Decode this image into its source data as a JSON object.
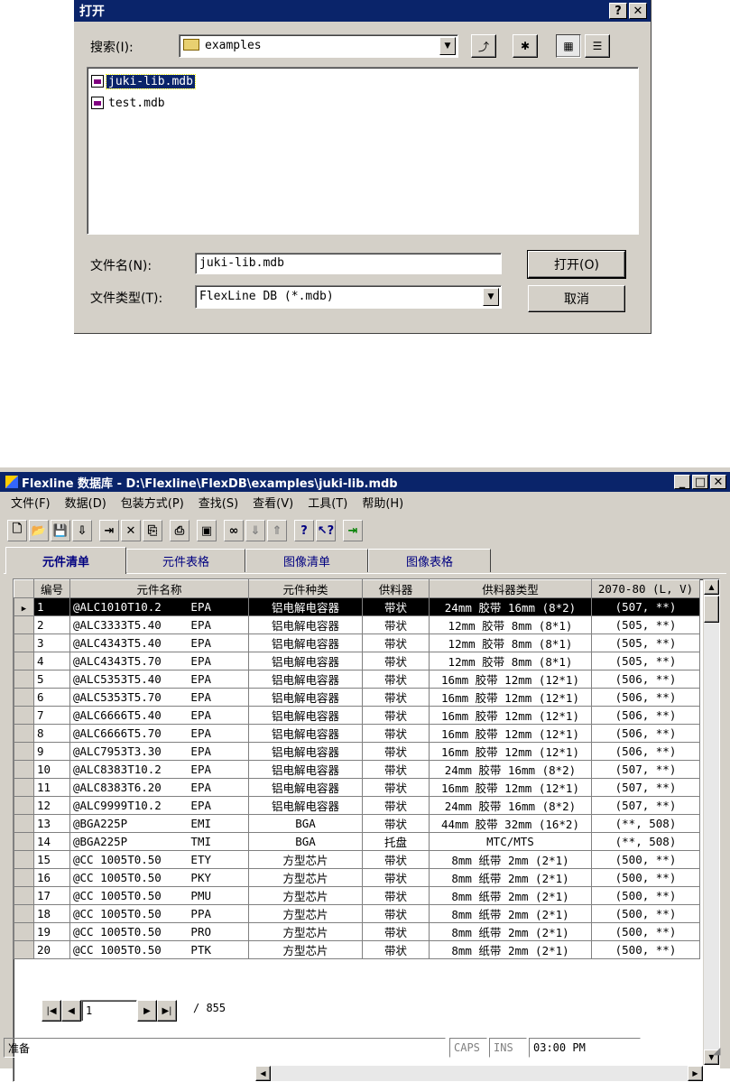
{
  "dialog": {
    "title": "打开",
    "search_label": "搜索(I):",
    "search_folder": "examples",
    "files": [
      "juki-lib.mdb",
      "test.mdb"
    ],
    "filename_label": "文件名(N):",
    "filename_value": "juki-lib.mdb",
    "filetype_label": "文件类型(T):",
    "filetype_value": "FlexLine DB (*.mdb)",
    "open_button": "打开(O)",
    "cancel_button": "取消",
    "help_glyph": "?",
    "close_glyph": "✕"
  },
  "app": {
    "title": "Flexline 数据库 - D:\\Flexline\\FlexDB\\examples\\juki-lib.mdb",
    "menu": [
      "文件(F)",
      "数据(D)",
      "包装方式(P)",
      "查找(S)",
      "查看(V)",
      "工具(T)",
      "帮助(H)"
    ],
    "tabs": [
      "元件清单",
      "元件表格",
      "图像清单",
      "图像表格"
    ],
    "columns": [
      "编号",
      "元件名称",
      "元件种类",
      "供料器",
      "供料器类型",
      "2070-80 (L, V)"
    ],
    "rows": [
      {
        "no": "1",
        "name": "@ALC1010T10.2",
        "mfr": "EPA",
        "kind": "铝电解电容器",
        "feeder": "带状",
        "ftype": "24mm 胶带 16mm (8*2)",
        "mach": "(507, **)"
      },
      {
        "no": "2",
        "name": "@ALC3333T5.40",
        "mfr": "EPA",
        "kind": "铝电解电容器",
        "feeder": "带状",
        "ftype": "12mm 胶带 8mm (8*1)",
        "mach": "(505, **)"
      },
      {
        "no": "3",
        "name": "@ALC4343T5.40",
        "mfr": "EPA",
        "kind": "铝电解电容器",
        "feeder": "带状",
        "ftype": "12mm 胶带 8mm (8*1)",
        "mach": "(505, **)"
      },
      {
        "no": "4",
        "name": "@ALC4343T5.70",
        "mfr": "EPA",
        "kind": "铝电解电容器",
        "feeder": "带状",
        "ftype": "12mm 胶带 8mm (8*1)",
        "mach": "(505, **)"
      },
      {
        "no": "5",
        "name": "@ALC5353T5.40",
        "mfr": "EPA",
        "kind": "铝电解电容器",
        "feeder": "带状",
        "ftype": "16mm 胶带 12mm (12*1)",
        "mach": "(506, **)"
      },
      {
        "no": "6",
        "name": "@ALC5353T5.70",
        "mfr": "EPA",
        "kind": "铝电解电容器",
        "feeder": "带状",
        "ftype": "16mm 胶带 12mm (12*1)",
        "mach": "(506, **)"
      },
      {
        "no": "7",
        "name": "@ALC6666T5.40",
        "mfr": "EPA",
        "kind": "铝电解电容器",
        "feeder": "带状",
        "ftype": "16mm 胶带 12mm (12*1)",
        "mach": "(506, **)"
      },
      {
        "no": "8",
        "name": "@ALC6666T5.70",
        "mfr": "EPA",
        "kind": "铝电解电容器",
        "feeder": "带状",
        "ftype": "16mm 胶带 12mm (12*1)",
        "mach": "(506, **)"
      },
      {
        "no": "9",
        "name": "@ALC7953T3.30",
        "mfr": "EPA",
        "kind": "铝电解电容器",
        "feeder": "带状",
        "ftype": "16mm 胶带 12mm (12*1)",
        "mach": "(506, **)"
      },
      {
        "no": "10",
        "name": "@ALC8383T10.2",
        "mfr": "EPA",
        "kind": "铝电解电容器",
        "feeder": "带状",
        "ftype": "24mm 胶带 16mm (8*2)",
        "mach": "(507, **)"
      },
      {
        "no": "11",
        "name": "@ALC8383T6.20",
        "mfr": "EPA",
        "kind": "铝电解电容器",
        "feeder": "带状",
        "ftype": "16mm 胶带 12mm (12*1)",
        "mach": "(507, **)"
      },
      {
        "no": "12",
        "name": "@ALC9999T10.2",
        "mfr": "EPA",
        "kind": "铝电解电容器",
        "feeder": "带状",
        "ftype": "24mm 胶带 16mm (8*2)",
        "mach": "(507, **)"
      },
      {
        "no": "13",
        "name": "@BGA225P",
        "mfr": "EMI",
        "kind": "BGA",
        "feeder": "带状",
        "ftype": "44mm 胶带 32mm (16*2)",
        "mach": "(**, 508)"
      },
      {
        "no": "14",
        "name": "@BGA225P",
        "mfr": "TMI",
        "kind": "BGA",
        "feeder": "托盘",
        "ftype": "MTC/MTS",
        "mach": "(**, 508)"
      },
      {
        "no": "15",
        "name": "@CC 1005T0.50",
        "mfr": "ETY",
        "kind": "方型芯片",
        "feeder": "带状",
        "ftype": "8mm 纸带 2mm (2*1)",
        "mach": "(500, **)"
      },
      {
        "no": "16",
        "name": "@CC 1005T0.50",
        "mfr": "PKY",
        "kind": "方型芯片",
        "feeder": "带状",
        "ftype": "8mm 纸带 2mm (2*1)",
        "mach": "(500, **)"
      },
      {
        "no": "17",
        "name": "@CC 1005T0.50",
        "mfr": "PMU",
        "kind": "方型芯片",
        "feeder": "带状",
        "ftype": "8mm 纸带 2mm (2*1)",
        "mach": "(500, **)"
      },
      {
        "no": "18",
        "name": "@CC 1005T0.50",
        "mfr": "PPA",
        "kind": "方型芯片",
        "feeder": "带状",
        "ftype": "8mm 纸带 2mm (2*1)",
        "mach": "(500, **)"
      },
      {
        "no": "19",
        "name": "@CC 1005T0.50",
        "mfr": "PRO",
        "kind": "方型芯片",
        "feeder": "带状",
        "ftype": "8mm 纸带 2mm (2*1)",
        "mach": "(500, **)"
      },
      {
        "no": "20",
        "name": "@CC 1005T0.50",
        "mfr": "PTK",
        "kind": "方型芯片",
        "feeder": "带状",
        "ftype": "8mm 纸带 2mm (2*1)",
        "mach": "(500, **)"
      }
    ],
    "nav": {
      "current": "1",
      "total": "/ 855"
    },
    "status": {
      "text": "准备",
      "caps": "CAPS",
      "ins": "INS",
      "time": "03:00 PM"
    }
  },
  "colors": {
    "titlebar": "#0a246a",
    "face": "#d4d0c8",
    "selection": "#0a246a"
  }
}
